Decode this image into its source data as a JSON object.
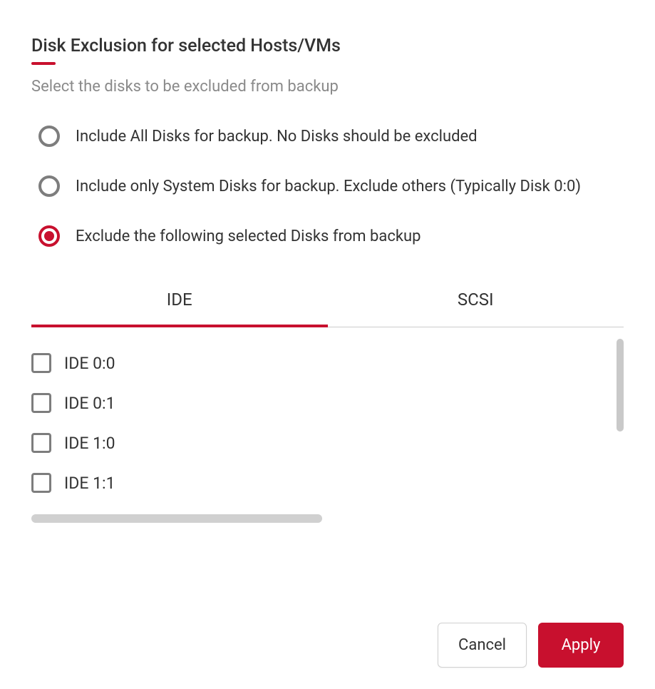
{
  "title": "Disk Exclusion for selected Hosts/VMs",
  "subtitle": "Select the disks to be excluded from backup",
  "radios": {
    "include_all": "Include All Disks for backup. No Disks should be excluded",
    "system_only": "Include only System Disks for backup. Exclude others (Typically Disk 0:0)",
    "exclude_selected": "Exclude the following selected Disks from backup"
  },
  "radio_selected": "exclude_selected",
  "tabs": {
    "ide": "IDE",
    "scsi": "SCSI"
  },
  "tab_active": "ide",
  "disks": [
    "IDE 0:0",
    "IDE 0:1",
    "IDE 1:0",
    "IDE 1:1"
  ],
  "buttons": {
    "cancel": "Cancel",
    "apply": "Apply"
  },
  "colors": {
    "accent": "#c8102e",
    "text": "#333",
    "muted": "#8a8a8a",
    "border": "#7d7d7d"
  }
}
